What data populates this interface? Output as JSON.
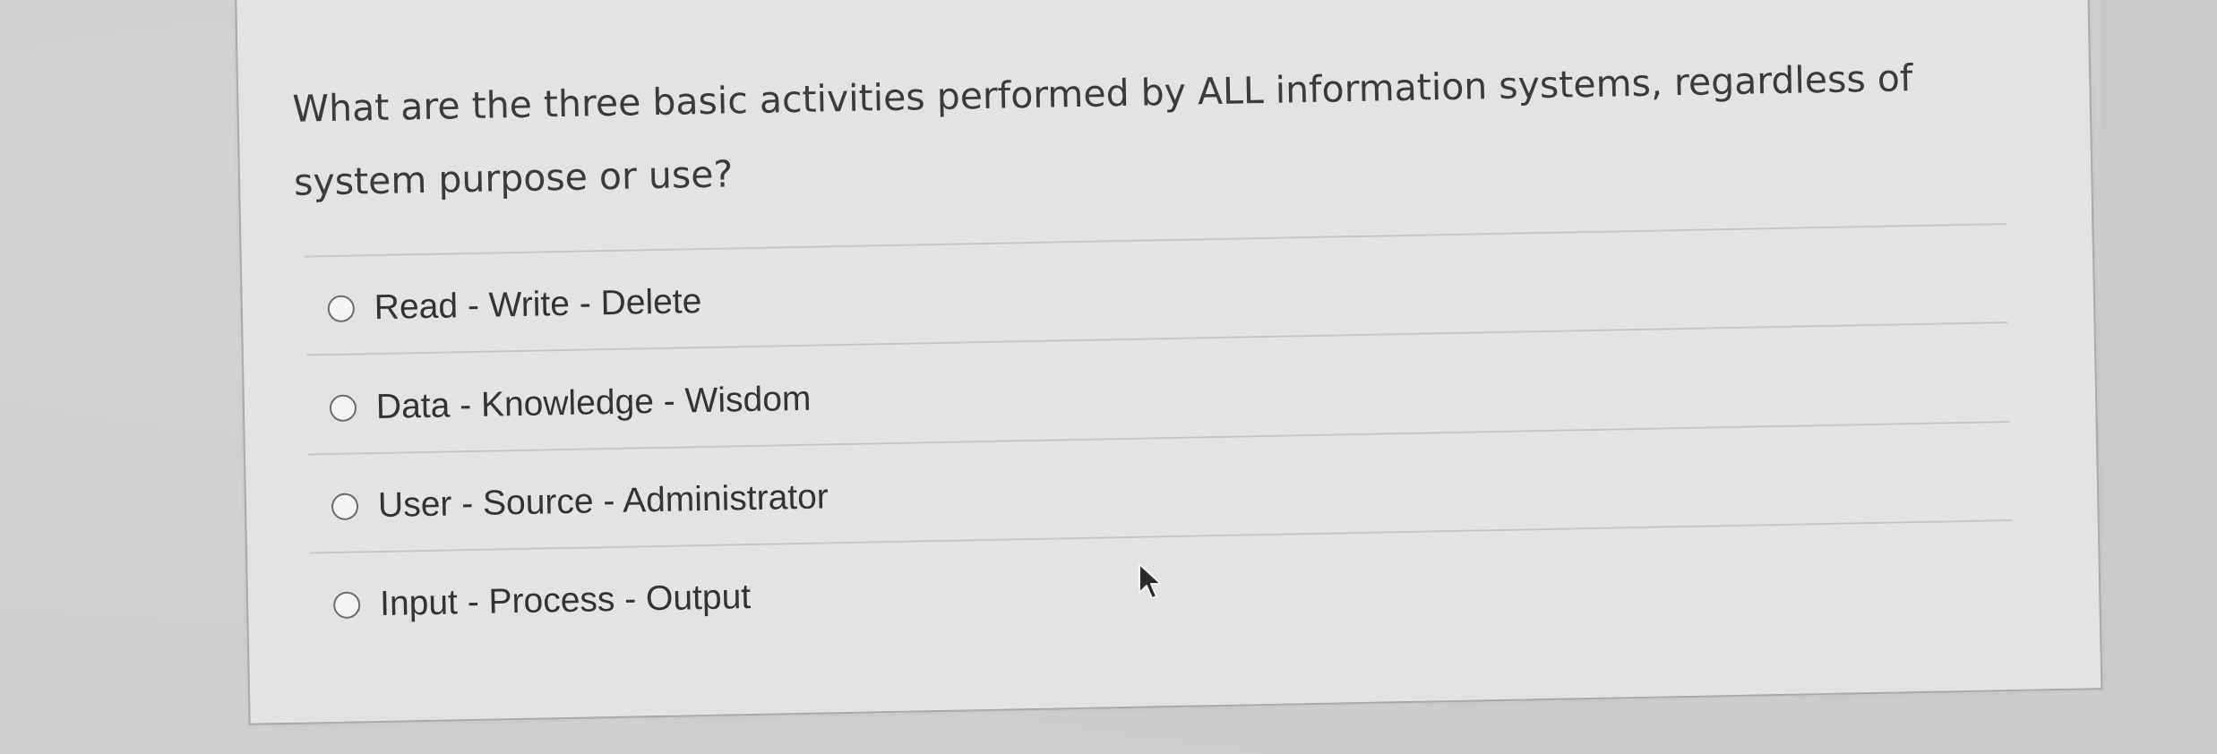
{
  "question": {
    "text": "What are the three basic activities performed by ALL information systems, regardless of system purpose or use?"
  },
  "options": [
    {
      "label": "Read - Write - Delete",
      "selected": false
    },
    {
      "label": "Data - Knowledge - Wisdom",
      "selected": false
    },
    {
      "label": "User - Source - Administrator",
      "selected": false
    },
    {
      "label": "Input - Process - Output",
      "selected": false
    }
  ],
  "cursor": {
    "icon": "mouse-pointer-icon"
  }
}
